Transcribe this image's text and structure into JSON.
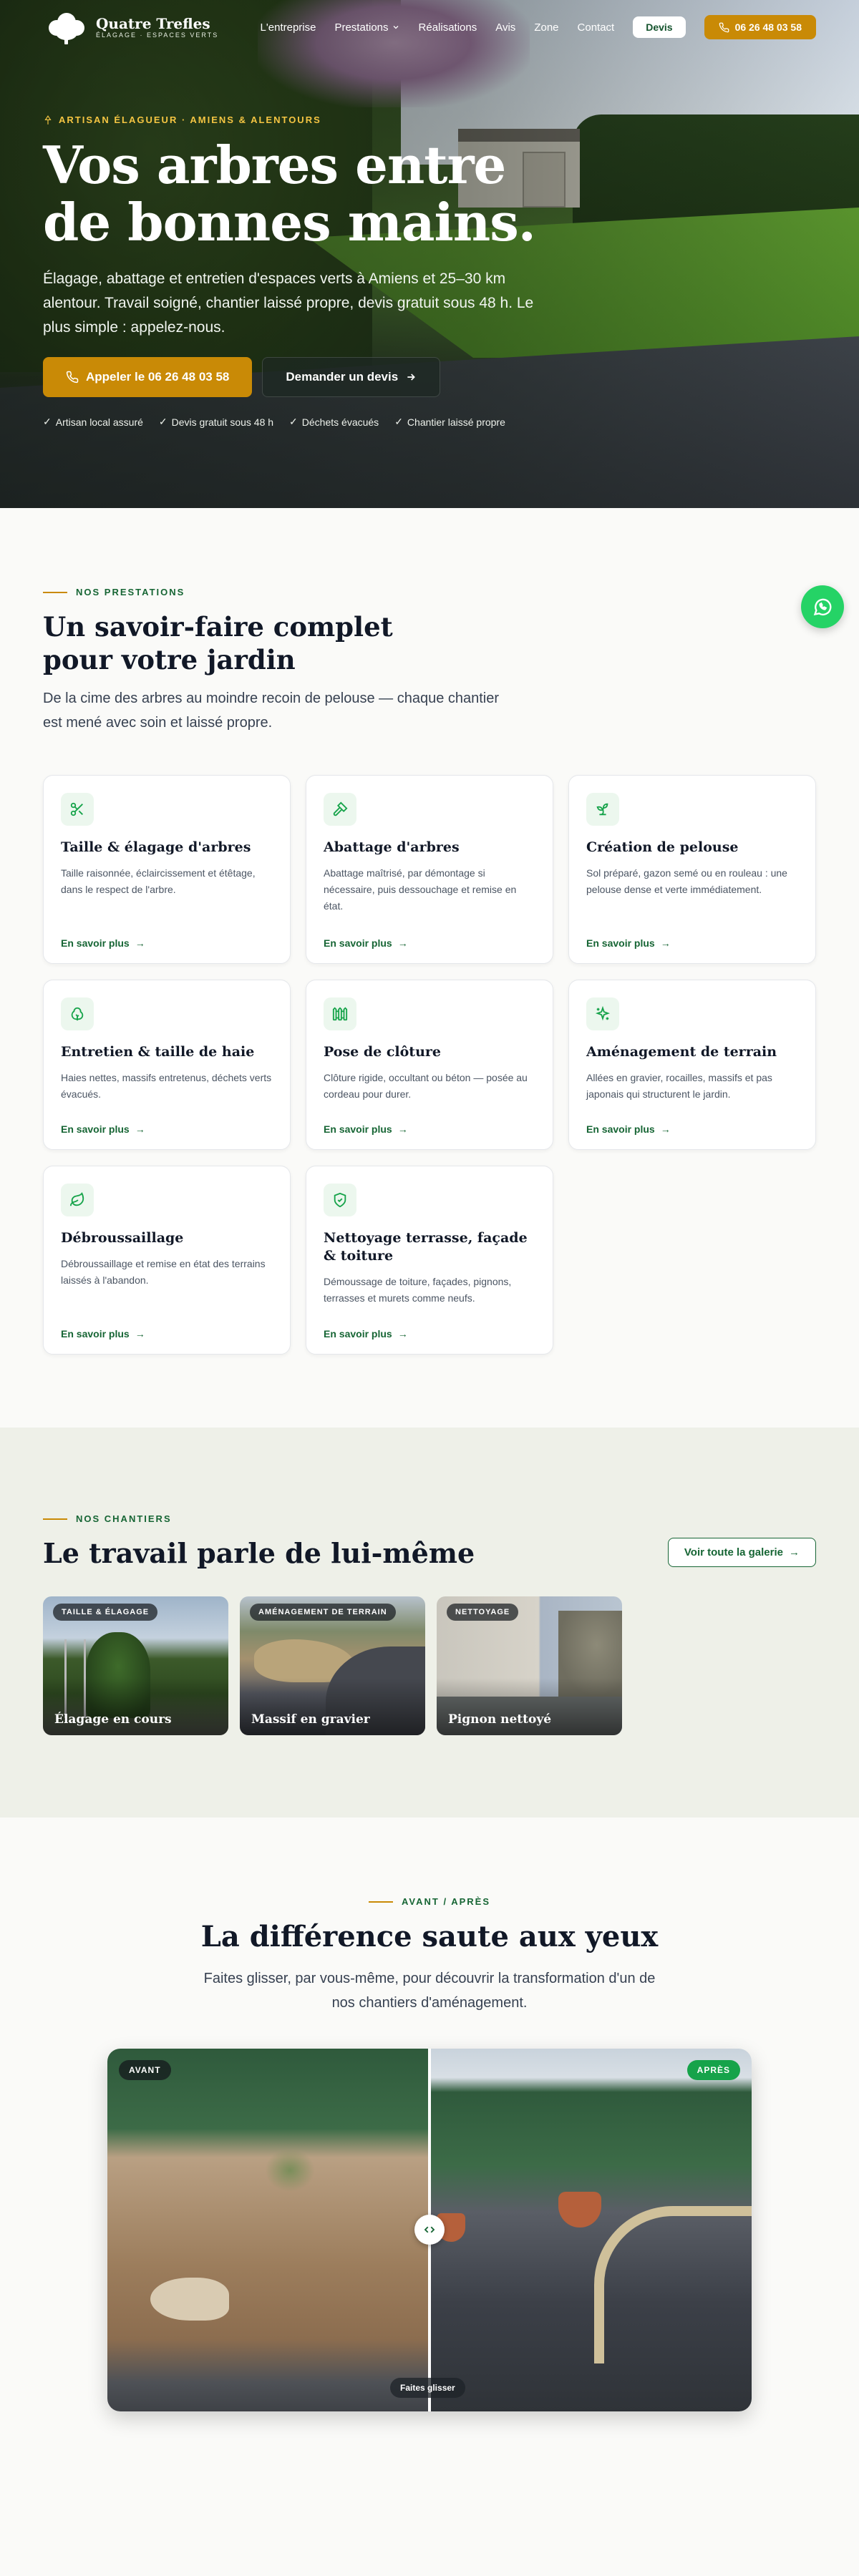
{
  "brand": {
    "name": "Quatre Trefles",
    "tagline": "ÉLAGAGE · ESPACES VERTS"
  },
  "nav": {
    "items": [
      {
        "label": "L'entreprise"
      },
      {
        "label": "Prestations",
        "chevron": "chevron-down-icon"
      },
      {
        "label": "Réalisations"
      },
      {
        "label": "Avis"
      },
      {
        "label": "Zone"
      },
      {
        "label": "Contact"
      }
    ],
    "devis_label": "Devis",
    "phone_label": "06 26 48 03 58"
  },
  "hero": {
    "eyebrow": "ARTISAN ÉLAGUEUR · AMIENS & ALENTOURS",
    "title_line1": "Vos arbres entre",
    "title_line2": "de bonnes mains.",
    "desc": "Élagage, abattage et entretien d'espaces verts à Amiens et 25–30 km alentour. Travail soigné, chantier laissé propre, devis gratuit sous 48 h. Le plus simple : appelez-nous.",
    "cta_call": "Appeler le 06 26 48 03 58",
    "cta_quote": "Demander un devis",
    "badges": [
      "Artisan local assuré",
      "Devis gratuit sous 48 h",
      "Déchets évacués",
      "Chantier laissé propre"
    ]
  },
  "services": {
    "label": "NOS PRESTATIONS",
    "title": "Un savoir-faire complet pour votre jardin",
    "desc": "De la cime des arbres au moindre recoin de pelouse — chaque chantier est mené avec soin et laissé propre.",
    "link_label": "En savoir plus",
    "items": [
      {
        "icon": "scissors-icon",
        "title": "Taille & élagage d'arbres",
        "desc": "Taille raisonnée, éclaircissement et étêtage, dans le respect de l'arbre."
      },
      {
        "icon": "hammer-icon",
        "title": "Abattage d'arbres",
        "desc": "Abattage maîtrisé, par démontage si nécessaire, puis dessouchage et remise en état."
      },
      {
        "icon": "sprout-icon",
        "title": "Création de pelouse",
        "desc": "Sol préparé, gazon semé ou en rouleau : une pelouse dense et verte immédiatement."
      },
      {
        "icon": "shrub-icon",
        "title": "Entretien & taille de haie",
        "desc": "Haies nettes, massifs entretenus, déchets verts évacués."
      },
      {
        "icon": "fence-icon",
        "title": "Pose de clôture",
        "desc": "Clôture rigide, occultant ou béton — posée au cordeau pour durer."
      },
      {
        "icon": "sparkles-icon",
        "title": "Aménagement de terrain",
        "desc": "Allées en gravier, rocailles, massifs et pas japonais qui structurent le jardin."
      },
      {
        "icon": "leaf-icon",
        "title": "Débroussaillage",
        "desc": "Débroussaillage et remise en état des terrains laissés à l'abandon."
      },
      {
        "icon": "shield-check-icon",
        "title": "Nettoyage terrasse, façade & toiture",
        "desc": "Démoussage de toiture, façades, pignons, terrasses et murets comme neufs."
      }
    ]
  },
  "chantiers": {
    "label": "NOS CHANTIERS",
    "title": "Le travail parle de lui-même",
    "gallery_btn": "Voir toute la galerie",
    "photos": [
      {
        "tag": "TAILLE & ÉLAGAGE",
        "caption": "Élagage en cours"
      },
      {
        "tag": "AMÉNAGEMENT DE TERRAIN",
        "caption": "Massif en gravier"
      },
      {
        "tag": "NETTOYAGE",
        "caption": "Pignon nettoyé"
      }
    ]
  },
  "before_after": {
    "label": "AVANT / APRÈS",
    "title": "La différence saute aux yeux",
    "desc": "Faites glisser, par vous-même, pour découvrir la transformation d'un de nos chantiers d'aménagement.",
    "before_tag": "AVANT",
    "after_tag": "APRÈS",
    "hint": "Faites glisser",
    "slider_position": 0.5
  },
  "colors": {
    "accent": "#c98a06",
    "brand_green": "#166534",
    "whatsapp": "#25d366"
  }
}
